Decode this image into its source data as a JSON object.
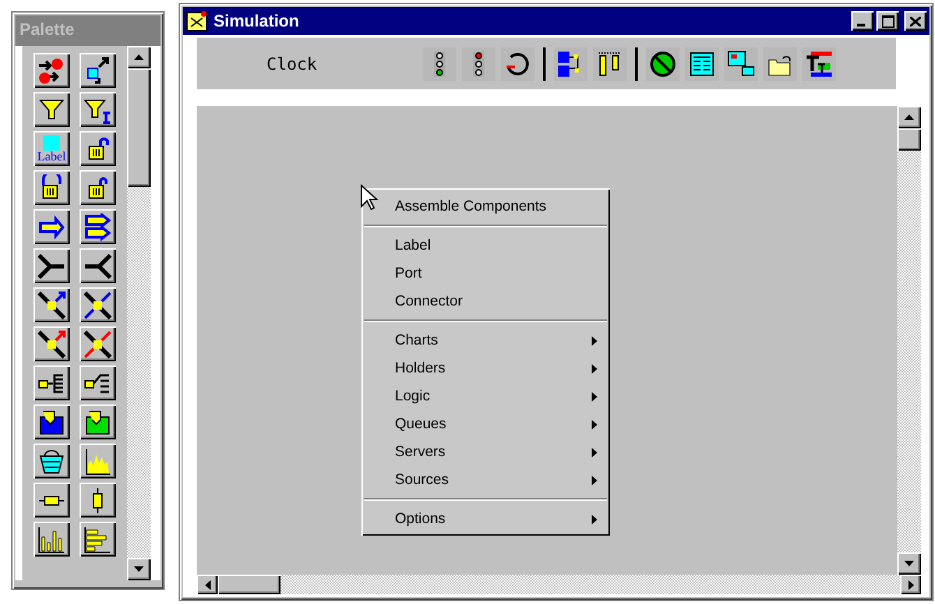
{
  "palette": {
    "title": "Palette",
    "label_tool": "Label"
  },
  "window": {
    "title": "Simulation"
  },
  "toolbar": {
    "label": "Clock"
  },
  "context_menu": {
    "sections": [
      [
        {
          "label": "Assemble Components",
          "submenu": false
        }
      ],
      [
        {
          "label": "Label",
          "submenu": false
        },
        {
          "label": "Port",
          "submenu": false
        },
        {
          "label": "Connector",
          "submenu": false
        }
      ],
      [
        {
          "label": "Charts",
          "submenu": true
        },
        {
          "label": "Holders",
          "submenu": true
        },
        {
          "label": "Logic",
          "submenu": true
        },
        {
          "label": "Queues",
          "submenu": true
        },
        {
          "label": "Servers",
          "submenu": true
        },
        {
          "label": "Sources",
          "submenu": true
        }
      ],
      [
        {
          "label": "Options",
          "submenu": true
        }
      ]
    ]
  }
}
